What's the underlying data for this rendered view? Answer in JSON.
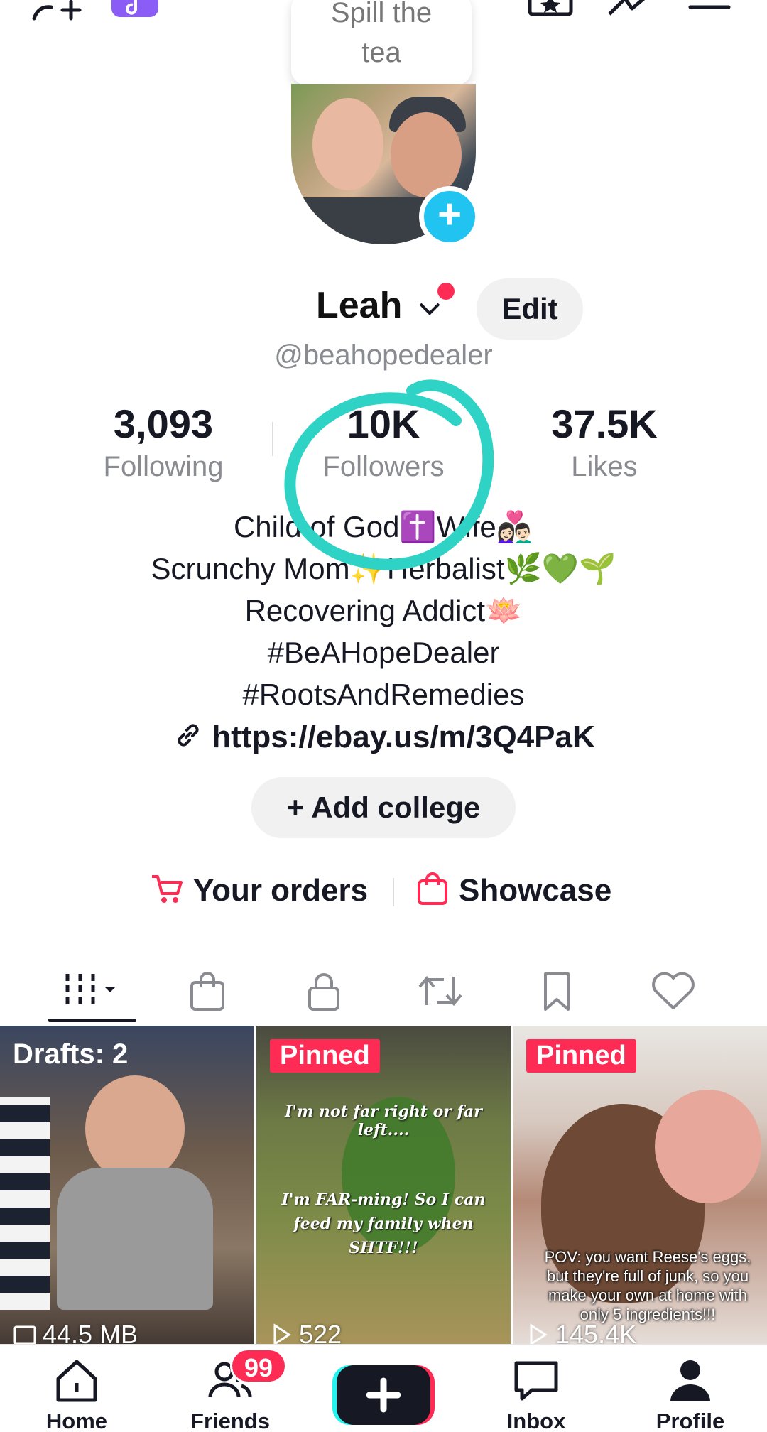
{
  "topbar": {
    "add_friend_icon": "add-friend-icon",
    "music_icon": "music-app-icon",
    "star_icon": "star-icon",
    "activity_icon": "activity-icon",
    "menu_icon": "menu-icon"
  },
  "tooltip": {
    "text": "Spill the tea"
  },
  "profile": {
    "name": "Leah",
    "edit_label": "Edit",
    "handle": "@beahopedealer"
  },
  "stats": {
    "following": {
      "value": "3,093",
      "label": "Following"
    },
    "followers": {
      "value": "10K",
      "label": "Followers"
    },
    "likes": {
      "value": "37.5K",
      "label": "Likes"
    }
  },
  "bio": {
    "line1": "Child of God✝️Wife👩🏻‍❤️‍👨🏻",
    "line2": "Scrunchy Mom✨Herbalist🌿💚🌱",
    "line3": "Recovering Addict🪷",
    "line4": "#BeAHopeDealer",
    "line5": "#RootsAndRemedies",
    "link": "https://ebay.us/m/3Q4PaK"
  },
  "college_button": "+ Add college",
  "shop": {
    "orders_label": "Your orders",
    "showcase_label": "Showcase"
  },
  "colors": {
    "accent_red": "#fe2c55",
    "accent_cyan": "#21c4f1",
    "scribble": "#2fd3c6"
  },
  "videos": [
    {
      "label": "Drafts: 2",
      "footer": "44.5 MB"
    },
    {
      "label": "Pinned",
      "caption_top": "I'm not far right or far left....",
      "caption_mid": "I'm FAR-ming! So I can feed my family when SHTF!!!",
      "footer": "522"
    },
    {
      "label": "Pinned",
      "caption": "POV: you want Reese's eggs, but they're full of junk, so you make your own at home with only 5 ingredients!!!",
      "footer": "145.4K"
    }
  ],
  "nav": {
    "home": "Home",
    "friends": "Friends",
    "friends_badge": "99",
    "inbox": "Inbox",
    "profile": "Profile"
  }
}
